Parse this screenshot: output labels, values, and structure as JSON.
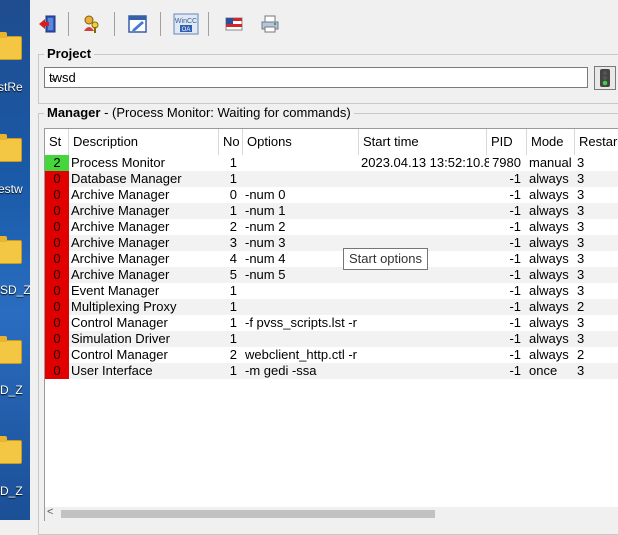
{
  "desktop": {
    "labels": [
      "stRe",
      "estw",
      "SD_Z",
      "D_Z",
      "D_Z"
    ]
  },
  "toolbar": {
    "buttons": [
      "exit-icon",
      "users-key-icon",
      "edit-icon",
      "wincc-oa-icon",
      "flag-icon",
      "printer-icon"
    ],
    "wincc_label": "WinCC OA"
  },
  "project": {
    "title": "Project",
    "selected": "twsd"
  },
  "manager": {
    "title": "Manager",
    "subtitle": "- (Process Monitor: Waiting for commands)",
    "columns": [
      "St",
      "Description",
      "No",
      "Options",
      "Start time",
      "PID",
      "Mode",
      "Restar"
    ],
    "rows": [
      {
        "st": "2",
        "desc": "Process Monitor",
        "no": "1",
        "opt": "",
        "start": "2023.04.13 13:52:10.8",
        "pid": "7980",
        "mode": "manual",
        "restart": "3"
      },
      {
        "st": "0",
        "desc": "Database Manager",
        "no": "1",
        "opt": "",
        "start": "",
        "pid": "-1",
        "mode": "always",
        "restart": "3"
      },
      {
        "st": "0",
        "desc": "Archive Manager",
        "no": "0",
        "opt": "-num 0",
        "start": "",
        "pid": "-1",
        "mode": "always",
        "restart": "3"
      },
      {
        "st": "0",
        "desc": "Archive Manager",
        "no": "1",
        "opt": "-num 1",
        "start": "",
        "pid": "-1",
        "mode": "always",
        "restart": "3"
      },
      {
        "st": "0",
        "desc": "Archive Manager",
        "no": "2",
        "opt": "-num 2",
        "start": "",
        "pid": "-1",
        "mode": "always",
        "restart": "3"
      },
      {
        "st": "0",
        "desc": "Archive Manager",
        "no": "3",
        "opt": "-num 3",
        "start": "",
        "pid": "-1",
        "mode": "always",
        "restart": "3"
      },
      {
        "st": "0",
        "desc": "Archive Manager",
        "no": "4",
        "opt": "-num 4",
        "start": "",
        "pid": "-1",
        "mode": "always",
        "restart": "3"
      },
      {
        "st": "0",
        "desc": "Archive Manager",
        "no": "5",
        "opt": "-num 5",
        "start": "",
        "pid": "-1",
        "mode": "always",
        "restart": "3"
      },
      {
        "st": "0",
        "desc": "Event Manager",
        "no": "1",
        "opt": "",
        "start": "",
        "pid": "-1",
        "mode": "always",
        "restart": "3"
      },
      {
        "st": "0",
        "desc": "Multiplexing Proxy",
        "no": "1",
        "opt": "",
        "start": "",
        "pid": "-1",
        "mode": "always",
        "restart": "2"
      },
      {
        "st": "0",
        "desc": "Control Manager",
        "no": "1",
        "opt": "-f pvss_scripts.lst -r",
        "start": "",
        "pid": "-1",
        "mode": "always",
        "restart": "3"
      },
      {
        "st": "0",
        "desc": "Simulation Driver",
        "no": "1",
        "opt": "",
        "start": "",
        "pid": "-1",
        "mode": "always",
        "restart": "3"
      },
      {
        "st": "0",
        "desc": "Control Manager",
        "no": "2",
        "opt": "webclient_http.ctl -r",
        "start": "",
        "pid": "-1",
        "mode": "always",
        "restart": "2"
      },
      {
        "st": "0",
        "desc": "User Interface",
        "no": "1",
        "opt": "-m gedi -ssa",
        "start": "",
        "pid": "-1",
        "mode": "once",
        "restart": "3"
      }
    ],
    "tooltip": "Start options"
  },
  "colors": {
    "running": "#44d63a",
    "stopped": "#e00000"
  }
}
